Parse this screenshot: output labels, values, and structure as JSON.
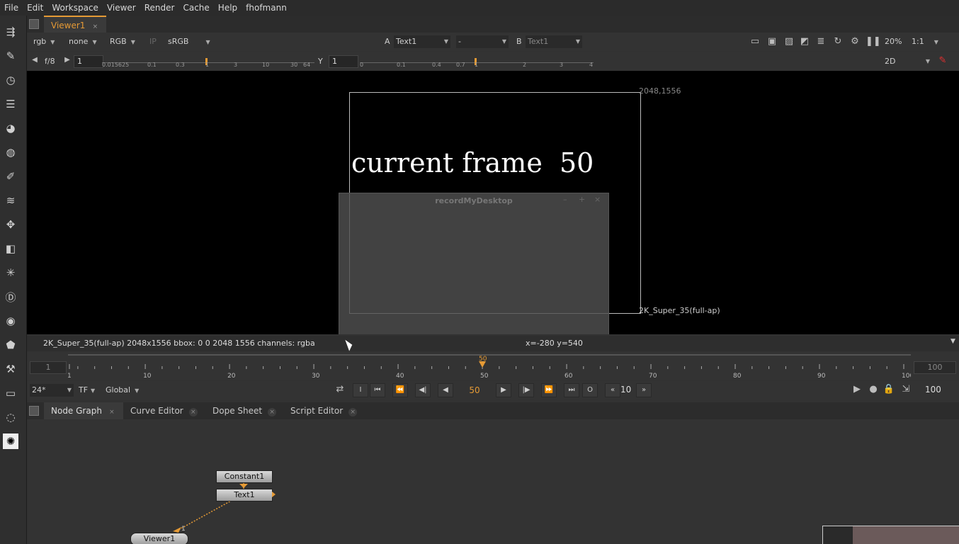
{
  "menu": [
    "File",
    "Edit",
    "Workspace",
    "Viewer",
    "Render",
    "Cache",
    "Help",
    "fhofmann"
  ],
  "viewer_tab": {
    "label": "Viewer1",
    "close": "×"
  },
  "viewer_controls": {
    "channel": "rgb",
    "alpha": "none",
    "display": "RGB",
    "ip": "IP",
    "lut": "sRGB",
    "a_label": "A",
    "a_input": "Text1",
    "wipe": "-",
    "b_label": "B",
    "b_input": "Text1",
    "zoom": "20%",
    "ratio": "1:1",
    "fstop": "f/8",
    "gain": "1",
    "y_label": "Y",
    "gamma": "1",
    "view_mode": "2D",
    "gain_ticks": [
      "0.015625",
      "0.1",
      "0.3",
      "1",
      "3",
      "10",
      "30",
      "64"
    ],
    "gamma_ticks": [
      "0",
      "0.1",
      "0.4",
      "0.7",
      "1",
      "2",
      "3",
      "4"
    ]
  },
  "canvas": {
    "frame_text": "current frame  50",
    "corner_label": "2048,1556",
    "format_label": "2K_Super_35(full-ap)",
    "overlay_title": "recordMyDesktop"
  },
  "info_bar": {
    "format": "2K_Super_35(full-ap) 2048x1556  bbox: 0 0 2048 1556 channels: rgba",
    "coords": "x=-280 y=540"
  },
  "timeline": {
    "start": "1",
    "end": "100",
    "current": "50",
    "ticks": [
      "1",
      "10",
      "20",
      "30",
      "40",
      "50",
      "60",
      "70",
      "80",
      "90",
      "100"
    ]
  },
  "playback": {
    "fps": "24*",
    "tf": "TF",
    "range": "Global",
    "frame": "50",
    "skip": "10",
    "end_frame": "100",
    "o_label": "O",
    "i_label": "I"
  },
  "bottom_tabs": [
    {
      "label": "Node Graph",
      "close": "×"
    },
    {
      "label": "Curve Editor",
      "close": "×"
    },
    {
      "label": "Dope Sheet",
      "close": "×"
    },
    {
      "label": "Script Editor",
      "close": "×"
    }
  ],
  "nodes": {
    "constant": "Constant1",
    "text": "Text1",
    "viewer": "Viewer1",
    "pipe_number": "1"
  },
  "colors": {
    "accent": "#e59a35",
    "background": "#323232",
    "viewer_bg": "#000000"
  }
}
